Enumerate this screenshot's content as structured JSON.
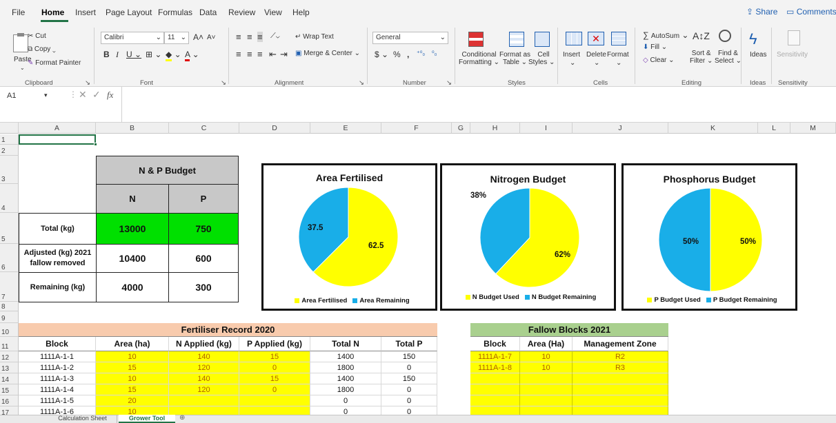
{
  "menu": {
    "items": [
      "File",
      "Home",
      "Insert",
      "Page Layout",
      "Formulas",
      "Data",
      "Review",
      "View",
      "Help"
    ],
    "share": "Share",
    "comments": "Comments"
  },
  "ribbon": {
    "clipboard": {
      "paste": "Paste",
      "cut": "Cut",
      "copy": "Copy",
      "format_painter": "Format Painter",
      "group": "Clipboard"
    },
    "font": {
      "name": "Calibri",
      "size": "11",
      "group": "Font"
    },
    "alignment": {
      "wrap": "Wrap Text",
      "merge": "Merge & Center",
      "group": "Alignment"
    },
    "number": {
      "format": "General",
      "group": "Number"
    },
    "styles": {
      "cond": "Conditional",
      "cond2": "Formatting",
      "fmt_table": "Format as",
      "fmt_table2": "Table",
      "cell_styles": "Cell",
      "cell_styles2": "Styles",
      "group": "Styles"
    },
    "cells": {
      "insert": "Insert",
      "delete": "Delete",
      "format": "Format",
      "group": "Cells"
    },
    "editing": {
      "autosum": "AutoSum",
      "fill": "Fill",
      "clear": "Clear",
      "sort": "Sort &",
      "sort2": "Filter",
      "find": "Find &",
      "find2": "Select",
      "group": "Editing"
    },
    "ideas": {
      "label": "Ideas",
      "group": "Ideas"
    },
    "sensitivity": {
      "label": "Sensitivity",
      "group": "Sensitivity"
    }
  },
  "formula_bar": {
    "name_box": "A1",
    "fx": "fx",
    "content": ""
  },
  "columns": [
    "A",
    "B",
    "C",
    "D",
    "E",
    "F",
    "G",
    "H",
    "I",
    "J",
    "K",
    "L",
    "M"
  ],
  "rows": [
    "1",
    "2",
    "3",
    "4",
    "5",
    "6",
    "7",
    "8",
    "9",
    "10",
    "11",
    "12",
    "13",
    "14",
    "15",
    "16",
    "17"
  ],
  "budget": {
    "title": "N & P Budget",
    "col_n": "N",
    "col_p": "P",
    "rows": [
      {
        "label": "Total (kg)",
        "n": "13000",
        "p": "750"
      },
      {
        "label": "Adjusted (kg) 2021 fallow removed",
        "n": "10400",
        "p": "600"
      },
      {
        "label": "Remaining (kg)",
        "n": "4000",
        "p": "300"
      }
    ]
  },
  "chart_data": [
    {
      "type": "pie",
      "title": "Area Fertilised",
      "categories": [
        "Area Fertilised",
        "Area Remaining"
      ],
      "values": [
        62.5,
        37.5
      ],
      "labels": [
        "62.5",
        "37.5"
      ],
      "colors": [
        "#ffff00",
        "#19aee8"
      ]
    },
    {
      "type": "pie",
      "title": "Nitrogen Budget",
      "categories": [
        "N Budget Used",
        "N Budget Remaining"
      ],
      "values": [
        62,
        38
      ],
      "labels": [
        "62%",
        "38%"
      ],
      "colors": [
        "#ffff00",
        "#19aee8"
      ]
    },
    {
      "type": "pie",
      "title": "Phosphorus Budget",
      "categories": [
        "P Budget Used",
        "P Budget Remaining"
      ],
      "values": [
        50,
        50
      ],
      "labels": [
        "50%",
        "50%"
      ],
      "colors": [
        "#ffff00",
        "#19aee8"
      ]
    }
  ],
  "fertiliser": {
    "title": "Fertiliser Record 2020",
    "headers": [
      "Block",
      "Area (ha)",
      "N Applied (kg)",
      "P Applied (kg)",
      "Total N",
      "Total P"
    ],
    "rows": [
      [
        "1111A-1-1",
        "10",
        "140",
        "15",
        "1400",
        "150"
      ],
      [
        "1111A-1-2",
        "15",
        "120",
        "0",
        "1800",
        "0"
      ],
      [
        "1111A-1-3",
        "10",
        "140",
        "15",
        "1400",
        "150"
      ],
      [
        "1111A-1-4",
        "15",
        "120",
        "0",
        "1800",
        "0"
      ],
      [
        "1111A-1-5",
        "20",
        "",
        "",
        "0",
        "0"
      ],
      [
        "1111A-1-6",
        "10",
        "",
        "",
        "0",
        "0"
      ]
    ]
  },
  "fallow": {
    "title": "Fallow Blocks 2021",
    "headers": [
      "Block",
      "Area (Ha)",
      "Management Zone"
    ],
    "rows": [
      [
        "1111A-1-7",
        "10",
        "R2"
      ],
      [
        "1111A-1-8",
        "10",
        "R3"
      ],
      [
        "",
        "",
        ""
      ],
      [
        "",
        "",
        ""
      ],
      [
        "",
        "",
        ""
      ],
      [
        "",
        "",
        ""
      ]
    ]
  },
  "tabs": [
    "Calculation Sheet",
    "Grower Tool"
  ],
  "colors": {
    "green": "#00e000",
    "grey": "#c8c8c8",
    "peach": "#f8cbad",
    "lightgreen": "#a9d08e",
    "yellow": "#ffff00",
    "blue": "#19aee8"
  }
}
